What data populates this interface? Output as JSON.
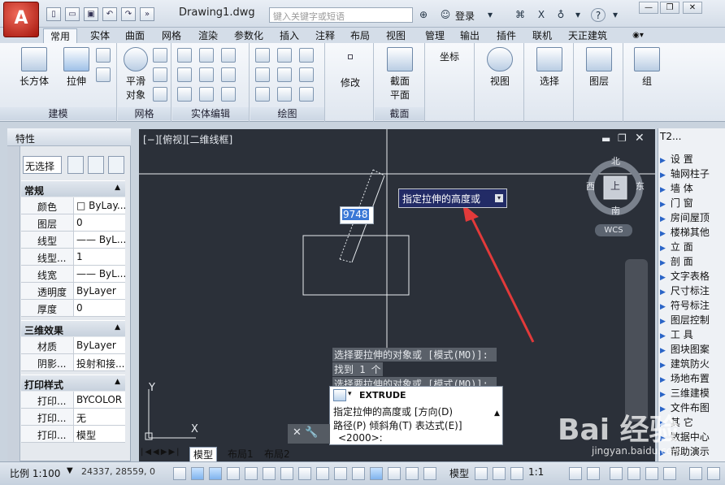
{
  "app": {
    "logo_text": "A",
    "doc_title": "Drawing1.dwg"
  },
  "search": {
    "placeholder": "键入关键字或短语"
  },
  "user": {
    "login_label": "登录"
  },
  "ribbon_tabs": [
    "常用",
    "实体",
    "曲面",
    "网格",
    "渲染",
    "参数化",
    "插入",
    "注释",
    "布局",
    "视图",
    "管理",
    "输出",
    "插件",
    "联机",
    "天正建筑"
  ],
  "ribbon": {
    "modeling": {
      "box_label": "长方体",
      "extrude_label": "拉伸",
      "group_label": "建模"
    },
    "mesh": {
      "smooth_label": "平滑",
      "smooth_label2": "对象",
      "group_label": "网格"
    },
    "solid_edit": {
      "group_label": "实体编辑"
    },
    "draw": {
      "group_label": "绘图"
    },
    "modify": {
      "label": "修改"
    },
    "section": {
      "label": "截面",
      "label2": "平面",
      "group_label": "截面"
    },
    "coords": {
      "label": "坐标"
    },
    "view": {
      "label": "视图"
    },
    "select": {
      "label": "选择"
    },
    "layer": {
      "label": "图层"
    },
    "group": {
      "label": "组"
    }
  },
  "properties": {
    "title": "特性",
    "selector": "无选择",
    "sections": {
      "general": "常规",
      "3d": "三维效果",
      "plot": "打印样式"
    },
    "general_rows": [
      {
        "key": "颜色",
        "value": "□ ByLay..."
      },
      {
        "key": "图层",
        "value": "0"
      },
      {
        "key": "线型",
        "value": "—— ByL..."
      },
      {
        "key": "线型...",
        "value": "1"
      },
      {
        "key": "线宽",
        "value": "—— ByL..."
      },
      {
        "key": "透明度",
        "value": "ByLayer"
      },
      {
        "key": "厚度",
        "value": "0"
      }
    ],
    "3d_rows": [
      {
        "key": "材质",
        "value": "ByLayer"
      },
      {
        "key": "阴影...",
        "value": "投射和接..."
      }
    ],
    "plot_rows": [
      {
        "key": "打印...",
        "value": "BYCOLOR"
      },
      {
        "key": "打印...",
        "value": "无"
      },
      {
        "key": "打印...",
        "value": "模型"
      }
    ]
  },
  "viewport": {
    "label": "[−][俯视][二维线框]",
    "compass": {
      "north": "北",
      "south": "南",
      "east": "东",
      "west": "西",
      "top": "上"
    },
    "wcs": "WCS",
    "ucs": {
      "y": "Y",
      "x": "X"
    }
  },
  "prompt": {
    "tooltip": "指定拉伸的高度或",
    "dyn_value": "9748"
  },
  "command": {
    "history": [
      "选择要拉伸的对象或 [模式(MO)]:",
      "找到 1 个",
      "选择要拉伸的对象或 [模式(MO)]:"
    ],
    "name": "EXTRUDE",
    "line1": "指定拉伸的高度或 [方向(D)",
    "line2": "路径(P) 倾斜角(T) 表达式(E)]",
    "line3": "<2000>:"
  },
  "right_panel": {
    "title": "T2...",
    "items": [
      "设 置",
      "轴网柱子",
      "墙 体",
      "门 窗",
      "房间屋顶",
      "楼梯其他",
      "立 面",
      "剖 面",
      "文字表格",
      "尺寸标注",
      "符号标注",
      "图层控制",
      "工 具",
      "图块图案",
      "建筑防火",
      "场地布置",
      "三维建模",
      "文件布图",
      "其 它",
      "数据中心",
      "帮助演示"
    ]
  },
  "layout_tabs": [
    "模型",
    "布局1",
    "布局2"
  ],
  "status": {
    "scale": "比例 1:100",
    "coords": "24337, 28559, 0",
    "model": "模型",
    "annot_scale": "1:1"
  },
  "watermark": {
    "text": "Bai 经验",
    "url": "jingyan.baidu.com"
  }
}
